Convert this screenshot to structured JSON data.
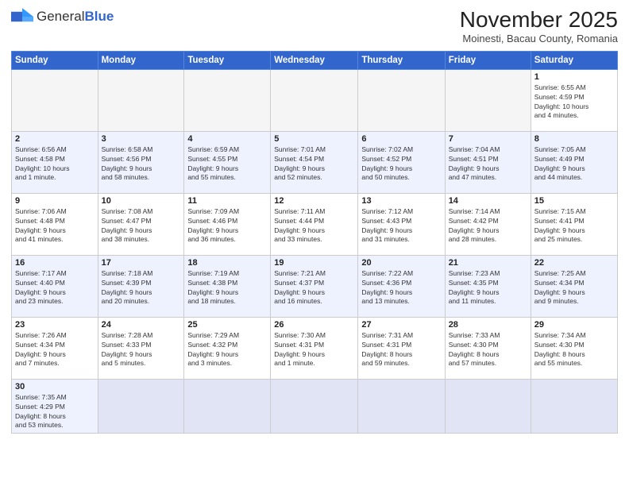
{
  "header": {
    "logo_general": "General",
    "logo_blue": "Blue",
    "month_title": "November 2025",
    "subtitle": "Moinesti, Bacau County, Romania"
  },
  "weekdays": [
    "Sunday",
    "Monday",
    "Tuesday",
    "Wednesday",
    "Thursday",
    "Friday",
    "Saturday"
  ],
  "weeks": [
    [
      {
        "day": "",
        "info": ""
      },
      {
        "day": "",
        "info": ""
      },
      {
        "day": "",
        "info": ""
      },
      {
        "day": "",
        "info": ""
      },
      {
        "day": "",
        "info": ""
      },
      {
        "day": "",
        "info": ""
      },
      {
        "day": "1",
        "info": "Sunrise: 6:55 AM\nSunset: 4:59 PM\nDaylight: 10 hours\nand 4 minutes."
      }
    ],
    [
      {
        "day": "2",
        "info": "Sunrise: 6:56 AM\nSunset: 4:58 PM\nDaylight: 10 hours\nand 1 minute."
      },
      {
        "day": "3",
        "info": "Sunrise: 6:58 AM\nSunset: 4:56 PM\nDaylight: 9 hours\nand 58 minutes."
      },
      {
        "day": "4",
        "info": "Sunrise: 6:59 AM\nSunset: 4:55 PM\nDaylight: 9 hours\nand 55 minutes."
      },
      {
        "day": "5",
        "info": "Sunrise: 7:01 AM\nSunset: 4:54 PM\nDaylight: 9 hours\nand 52 minutes."
      },
      {
        "day": "6",
        "info": "Sunrise: 7:02 AM\nSunset: 4:52 PM\nDaylight: 9 hours\nand 50 minutes."
      },
      {
        "day": "7",
        "info": "Sunrise: 7:04 AM\nSunset: 4:51 PM\nDaylight: 9 hours\nand 47 minutes."
      },
      {
        "day": "8",
        "info": "Sunrise: 7:05 AM\nSunset: 4:49 PM\nDaylight: 9 hours\nand 44 minutes."
      }
    ],
    [
      {
        "day": "9",
        "info": "Sunrise: 7:06 AM\nSunset: 4:48 PM\nDaylight: 9 hours\nand 41 minutes."
      },
      {
        "day": "10",
        "info": "Sunrise: 7:08 AM\nSunset: 4:47 PM\nDaylight: 9 hours\nand 38 minutes."
      },
      {
        "day": "11",
        "info": "Sunrise: 7:09 AM\nSunset: 4:46 PM\nDaylight: 9 hours\nand 36 minutes."
      },
      {
        "day": "12",
        "info": "Sunrise: 7:11 AM\nSunset: 4:44 PM\nDaylight: 9 hours\nand 33 minutes."
      },
      {
        "day": "13",
        "info": "Sunrise: 7:12 AM\nSunset: 4:43 PM\nDaylight: 9 hours\nand 31 minutes."
      },
      {
        "day": "14",
        "info": "Sunrise: 7:14 AM\nSunset: 4:42 PM\nDaylight: 9 hours\nand 28 minutes."
      },
      {
        "day": "15",
        "info": "Sunrise: 7:15 AM\nSunset: 4:41 PM\nDaylight: 9 hours\nand 25 minutes."
      }
    ],
    [
      {
        "day": "16",
        "info": "Sunrise: 7:17 AM\nSunset: 4:40 PM\nDaylight: 9 hours\nand 23 minutes."
      },
      {
        "day": "17",
        "info": "Sunrise: 7:18 AM\nSunset: 4:39 PM\nDaylight: 9 hours\nand 20 minutes."
      },
      {
        "day": "18",
        "info": "Sunrise: 7:19 AM\nSunset: 4:38 PM\nDaylight: 9 hours\nand 18 minutes."
      },
      {
        "day": "19",
        "info": "Sunrise: 7:21 AM\nSunset: 4:37 PM\nDaylight: 9 hours\nand 16 minutes."
      },
      {
        "day": "20",
        "info": "Sunrise: 7:22 AM\nSunset: 4:36 PM\nDaylight: 9 hours\nand 13 minutes."
      },
      {
        "day": "21",
        "info": "Sunrise: 7:23 AM\nSunset: 4:35 PM\nDaylight: 9 hours\nand 11 minutes."
      },
      {
        "day": "22",
        "info": "Sunrise: 7:25 AM\nSunset: 4:34 PM\nDaylight: 9 hours\nand 9 minutes."
      }
    ],
    [
      {
        "day": "23",
        "info": "Sunrise: 7:26 AM\nSunset: 4:34 PM\nDaylight: 9 hours\nand 7 minutes."
      },
      {
        "day": "24",
        "info": "Sunrise: 7:28 AM\nSunset: 4:33 PM\nDaylight: 9 hours\nand 5 minutes."
      },
      {
        "day": "25",
        "info": "Sunrise: 7:29 AM\nSunset: 4:32 PM\nDaylight: 9 hours\nand 3 minutes."
      },
      {
        "day": "26",
        "info": "Sunrise: 7:30 AM\nSunset: 4:31 PM\nDaylight: 9 hours\nand 1 minute."
      },
      {
        "day": "27",
        "info": "Sunrise: 7:31 AM\nSunset: 4:31 PM\nDaylight: 8 hours\nand 59 minutes."
      },
      {
        "day": "28",
        "info": "Sunrise: 7:33 AM\nSunset: 4:30 PM\nDaylight: 8 hours\nand 57 minutes."
      },
      {
        "day": "29",
        "info": "Sunrise: 7:34 AM\nSunset: 4:30 PM\nDaylight: 8 hours\nand 55 minutes."
      }
    ],
    [
      {
        "day": "30",
        "info": "Sunrise: 7:35 AM\nSunset: 4:29 PM\nDaylight: 8 hours\nand 53 minutes."
      },
      {
        "day": "",
        "info": ""
      },
      {
        "day": "",
        "info": ""
      },
      {
        "day": "",
        "info": ""
      },
      {
        "day": "",
        "info": ""
      },
      {
        "day": "",
        "info": ""
      },
      {
        "day": "",
        "info": ""
      }
    ]
  ]
}
